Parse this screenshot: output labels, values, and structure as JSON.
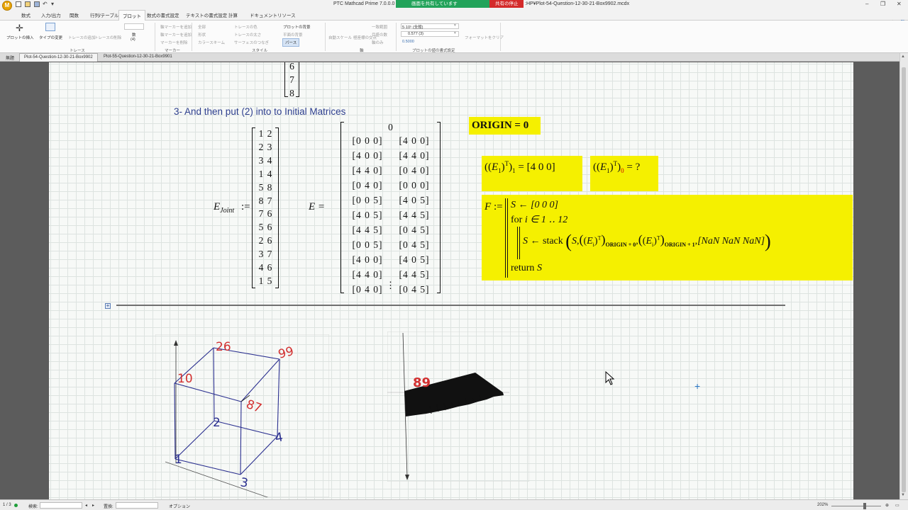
{
  "window": {
    "title": "PTC Mathcad Prime 7.0.0.0 - [P",
    "file_title": ":HP¥Plot-54-Question-12-30-21-Box9902.mcdx",
    "share_banner": "画面を共有しています",
    "stop_share": "共有の停止"
  },
  "tabs": [
    "数式",
    "入力/出力",
    "関数",
    "行列/テーブル",
    "プロット",
    "数式の書式設定",
    "テキストの書式設定",
    "計算",
    "ドキュメント",
    "リソース"
  ],
  "ribbon": {
    "insert_plot": "プロットの挿入",
    "change_type": "タイプの変更",
    "add_trace": "トレースの追加",
    "remove_trace": "トレースの削除",
    "trace_group": "トレース",
    "count": "数",
    "count_value": "(4)",
    "marker_items": [
      "軸マーカーを追加",
      "軸マーカーを追加",
      "マーカーを削除"
    ],
    "marker_group": "マーカー",
    "style_a": [
      "全部",
      "形状",
      "カラースキーム"
    ],
    "style_b": [
      "トレースの色",
      "トレースの太さ",
      "サーフェスのつなぎ"
    ],
    "plot_bg": "プロットの背景",
    "plane_bg": "平面の背景",
    "pass": "パース",
    "style_group": "スタイル",
    "axis_items": [
      "自動スケール",
      "極座標の交点",
      "一致範囲",
      "目盛の数",
      "軸のみ"
    ],
    "axis_group": "軸",
    "fmt_1": "5·10⁵ (全般)",
    "fmt_2": "0.577 (3)",
    "fmt_3": "0.5000",
    "format_group": "プロットの値の書式設定",
    "format_clear": "フォーマットをクリア"
  },
  "doc_tabs": [
    "無題",
    "Plot-54-Question-12-30-21-Box9902",
    "Plot-55-Question-12-30-21-Box9901"
  ],
  "content": {
    "col_vector_tail": [
      "6",
      "7",
      "8"
    ],
    "heading": "3- And then put (2) into to Initial Matrices",
    "origin": "ORIGIN = 0",
    "ejoint_label": "E",
    "ejoint_sub": "Joint",
    "assign": ":=",
    "ejoint_rows": [
      [
        "1",
        "2"
      ],
      [
        "2",
        "3"
      ],
      [
        "3",
        "4"
      ],
      [
        "1",
        "4"
      ],
      [
        "5",
        "8"
      ],
      [
        "8",
        "7"
      ],
      [
        "7",
        "6"
      ],
      [
        "5",
        "6"
      ],
      [
        "2",
        "6"
      ],
      [
        "3",
        "7"
      ],
      [
        "4",
        "6"
      ],
      [
        "1",
        "5"
      ]
    ],
    "e_label": "E =",
    "e_header": "0",
    "e_left": [
      "[0 0 0]",
      "[4 0 0]",
      "[4 4 0]",
      "[0 4 0]",
      "[0 0 5]",
      "[4 0 5]",
      "[4 4 5]",
      "[0 0 5]",
      "[4 0 0]",
      "[4 4 0]",
      "[0 4 0]"
    ],
    "e_right": [
      "[4 0 0]",
      "[4 4 0]",
      "[0 4 0]",
      "[0 0 0]",
      "[4 0 5]",
      "[4 4 5]",
      "[0 4 5]",
      "[0 4 5]",
      "[4 0 5]",
      "[4 4 5]",
      "[0 4 5]"
    ],
    "e_ellipsis": "⋮",
    "eq1_result": "[4  0  0]",
    "eq1_sub": "1",
    "eq2_result": "?",
    "eq2_sub": "0",
    "func": {
      "name": "F",
      "line1": "S ← [0  0  0]",
      "line2_a": "for",
      "line2_b": "i ∈ 1 ‥ 12",
      "line3_a": "S ← stack",
      "origin0": "ORIGIN + 0",
      "origin1": "ORIGIN + 1",
      "nan_row": "[NaN  NaN  NaN]",
      "line4_a": "return",
      "line4_b": "S"
    }
  },
  "plots": {
    "cube_labels": [
      "26",
      "99",
      "10",
      "87",
      "2",
      "4",
      "1",
      "3"
    ],
    "shape_label": "89"
  },
  "status": {
    "page": "1 / 3",
    "search": "検索:",
    "replace": "置換:",
    "options": "オプション",
    "zoom": "202%"
  },
  "colors": {
    "highlight": "#f5f000",
    "heading": "#2e3f8f",
    "plot_lines": "#2a2f8f",
    "plot_labels": "#d23030"
  }
}
